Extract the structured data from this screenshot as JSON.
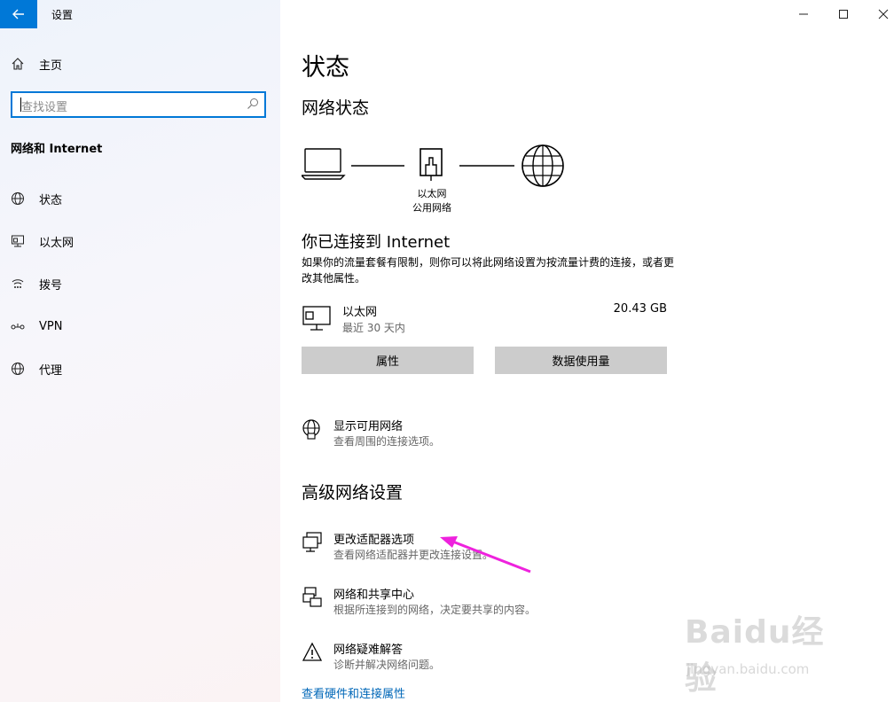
{
  "app": {
    "title": "设置"
  },
  "sidebar": {
    "home_label": "主页",
    "search_placeholder": "查找设置",
    "section_label": "网络和 Internet",
    "items": [
      {
        "label": "状态",
        "icon": "status-globe-icon"
      },
      {
        "label": "以太网",
        "icon": "ethernet-icon"
      },
      {
        "label": "拨号",
        "icon": "dialup-icon"
      },
      {
        "label": "VPN",
        "icon": "vpn-icon"
      },
      {
        "label": "代理",
        "icon": "proxy-globe-icon"
      }
    ]
  },
  "main": {
    "page_title": "状态",
    "network_status_title": "网络状态",
    "diagram": {
      "adapter_name": "以太网",
      "network_type": "公用网络"
    },
    "connected_heading": "你已连接到 Internet",
    "connected_desc": "如果你的流量套餐有限制，则你可以将此网络设置为按流量计费的连接，或者更改其他属性。",
    "ethernet": {
      "name": "以太网",
      "period": "最近 30 天内",
      "usage": "20.43 GB"
    },
    "buttons": {
      "properties": "属性",
      "data_usage": "数据使用量"
    },
    "show_networks": {
      "title": "显示可用网络",
      "desc": "查看周围的连接选项。"
    },
    "advanced_title": "高级网络设置",
    "advanced_items": [
      {
        "title": "更改适配器选项",
        "desc": "查看网络适配器并更改连接设置。"
      },
      {
        "title": "网络和共享中心",
        "desc": "根据所连接到的网络，决定要共享的内容。"
      },
      {
        "title": "网络疑难解答",
        "desc": "诊断并解决网络问题。"
      }
    ],
    "hardware_link": "查看硬件和连接属性"
  },
  "watermark": {
    "brand": "Baidu经验",
    "url": "jingyan.baidu.com"
  },
  "colors": {
    "accent": "#0078d7",
    "link": "#0067b8",
    "annotation_arrow": "#ee22dd",
    "button_bg": "#cccccc"
  }
}
